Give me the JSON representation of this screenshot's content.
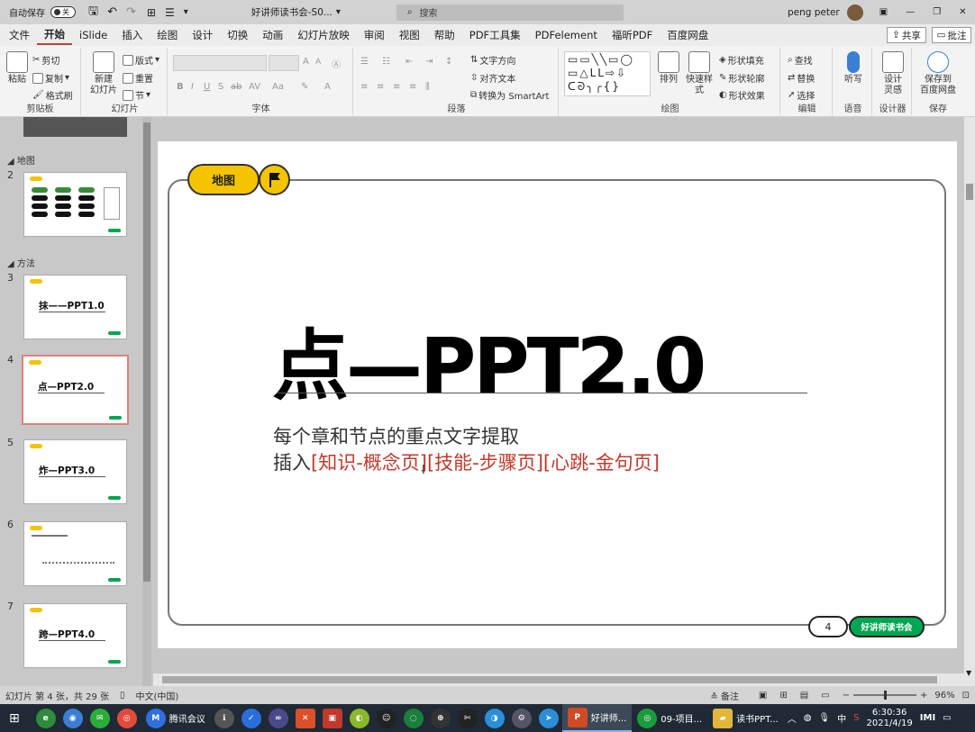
{
  "titlebar": {
    "autosave_label": "自动保存",
    "autosave_state": "关",
    "doc_title": "好讲师读书会-S0...",
    "search_placeholder": "搜索",
    "user": "peng peter"
  },
  "menu": {
    "tabs": [
      "文件",
      "开始",
      "iSlide",
      "插入",
      "绘图",
      "设计",
      "切换",
      "动画",
      "幻灯片放映",
      "审阅",
      "视图",
      "帮助",
      "PDF工具集",
      "PDFelement",
      "福昕PDF",
      "百度网盘"
    ],
    "active": "开始",
    "share": "共享",
    "comment": "批注"
  },
  "ribbon": {
    "clipboard": {
      "label": "剪贴板",
      "paste": "粘贴",
      "cut": "剪切",
      "copy": "复制",
      "format_painter": "格式刷"
    },
    "slides": {
      "label": "幻灯片",
      "new_slide": "新建\n幻灯片",
      "layout": "版式",
      "reset": "重置",
      "section": "节"
    },
    "font": {
      "label": "字体"
    },
    "paragraph": {
      "label": "段落",
      "text_direction": "文字方向",
      "align_text": "对齐文本",
      "smartart": "转换为 SmartArt"
    },
    "drawing": {
      "label": "绘图",
      "arrange": "排列",
      "quick_styles": "快速样式",
      "shape_fill": "形状填充",
      "shape_outline": "形状轮廓",
      "shape_effects": "形状效果"
    },
    "editing": {
      "label": "编辑",
      "find": "查找",
      "replace": "替换",
      "select": "选择"
    },
    "voice": {
      "label": "语音",
      "dictate": "听写"
    },
    "designer": {
      "label": "设计器",
      "design_ideas": "设计\n灵感"
    },
    "save": {
      "label": "保存",
      "save_baidu": "保存到\n百度网盘"
    }
  },
  "thumbnails": {
    "sections": [
      {
        "name": "地图"
      },
      {
        "name": "方法"
      }
    ],
    "slides": [
      {
        "num": "2",
        "title": ""
      },
      {
        "num": "3",
        "title": "抹——PPT1.0"
      },
      {
        "num": "4",
        "title": "点—PPT2.0"
      },
      {
        "num": "5",
        "title": "炸—PPT3.0"
      },
      {
        "num": "6",
        "title": ""
      },
      {
        "num": "7",
        "title": "跨—PPT4.0"
      }
    ]
  },
  "slide": {
    "tag": "地图",
    "title": "点—PPT2.0",
    "subtitle_line1": "每个章和节点的重点文字提取",
    "subtitle_line2_prefix": "插入",
    "subtitle_line2_links": "[知识-概念页][技能-步骤页][心跳-金句页]",
    "page_number": "4",
    "brand": "好讲师读书会",
    "colors": {
      "accent_yellow": "#f5c400",
      "brand_green": "#00a651",
      "link_red": "#c0392b"
    }
  },
  "status": {
    "slide_info": "幻灯片 第 4 张，共 29 张",
    "language": "中文(中国)",
    "notes": "备注",
    "zoom": "96%"
  },
  "taskbar": {
    "apps": [
      {
        "label": "腾讯会议"
      },
      {
        "label": "好讲师..."
      },
      {
        "label": "09-项目..."
      },
      {
        "label": "读书PPT..."
      }
    ],
    "tray_ime": "中",
    "time": "6:30:36",
    "date": "2021/4/19"
  }
}
